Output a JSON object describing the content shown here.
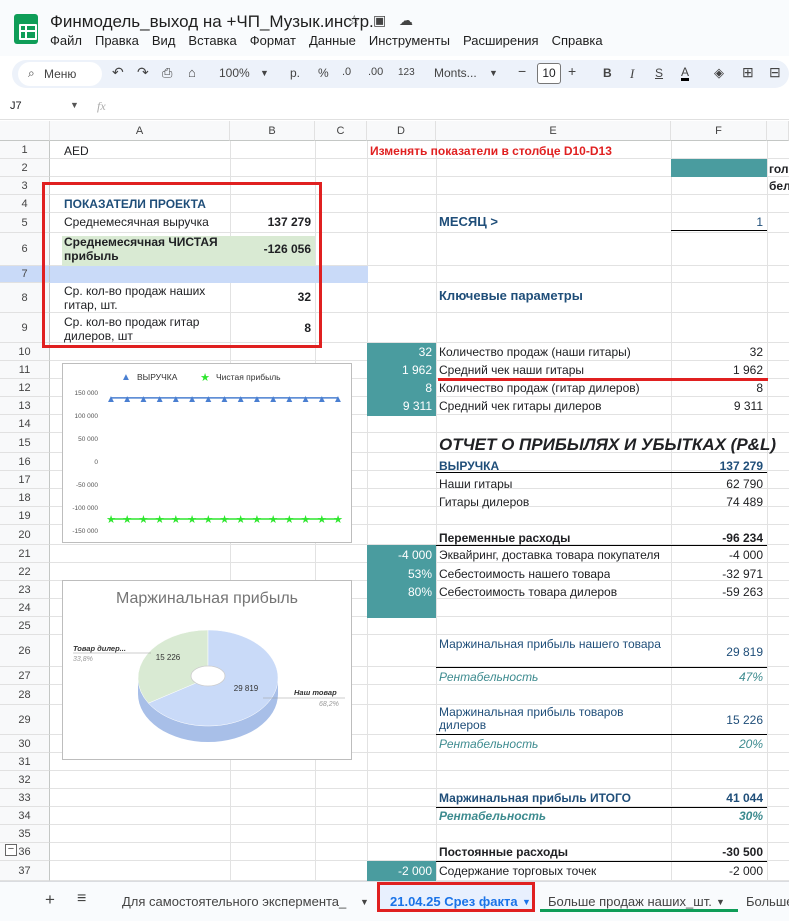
{
  "title": "Финмодель_выход на +ЧП_Музык.инстр.",
  "menu": [
    "Файл",
    "Правка",
    "Вид",
    "Вставка",
    "Формат",
    "Данные",
    "Инструменты",
    "Расширения",
    "Справка"
  ],
  "toolbar": {
    "search": "Меню",
    "zoom": "100%",
    "currency": "р.",
    "percent": "%",
    "dec_dec": ".0",
    "dec_inc": ".00",
    "numfmt": "123",
    "font": "Monts...",
    "font_size": "10",
    "bold": "B",
    "italic": "I",
    "textcolor": "A"
  },
  "formula_bar": {
    "cell_ref": "J7",
    "fx": "fx"
  },
  "columns": [
    "A",
    "B",
    "C",
    "D",
    "E",
    "F"
  ],
  "rows": [
    "1",
    "2",
    "3",
    "4",
    "5",
    "6",
    "7",
    "8",
    "9",
    "10",
    "11",
    "12",
    "13",
    "14",
    "15",
    "16",
    "17",
    "18",
    "19",
    "20",
    "21",
    "22",
    "23",
    "24",
    "25",
    "26",
    "27",
    "28",
    "29",
    "30",
    "31",
    "32",
    "33",
    "34",
    "35",
    "36",
    "37"
  ],
  "cells": {
    "a1": "AED",
    "d1": "Изменять показатели в столбце D10-D13",
    "g2": "гол",
    "g3": "бел",
    "a4": "ПОКАЗАТЕЛИ ПРОЕКТА",
    "a5": "Среднемесячная выручка",
    "b5": "137 279",
    "a6": "Среднемесячная ЧИСТАЯ прибыль",
    "b6": "-126 056",
    "a8": "Ср. кол-во продаж наших гитар, шт.",
    "b8": "32",
    "a9": "Ср. кол-во продаж гитар дилеров, шт",
    "b9": "8",
    "e5": "МЕСЯЦ >",
    "f5": "1",
    "e8": "Ключевые параметры",
    "d10": "32",
    "e10": "Количество продаж (наши гитары)",
    "f10": "32",
    "d11": "1 962",
    "e11": "Средний чек наши гитары",
    "f11": "1 962",
    "d12": "8",
    "e12": "Количество продаж (гитар дилеров)",
    "f12": "8",
    "d13": "9 311",
    "e13": "Средний чек гитары дилеров",
    "f13": "9 311",
    "e15": "ОТЧЕТ О ПРИБЫЛЯХ И УБЫТКАХ (P&L)",
    "e16": "ВЫРУЧКА",
    "f16": "137 279",
    "e17": "Наши гитары",
    "f17": "62 790",
    "e18": "Гитары дилеров",
    "f18": "74 489",
    "e20": "Переменные расходы",
    "f20": "-96 234",
    "d21": "-4 000",
    "e21": "Эквайринг, доставка товара покупателя",
    "f21": "-4 000",
    "d22": "53%",
    "e22": "Себестоимость нашего товара",
    "f22": "-32 971",
    "d23": "80%",
    "e23": "Себестоимость товара дилеров",
    "f23": "-59 263",
    "e26": "Маржинальная прибыль нашего товара",
    "f26": "29 819",
    "e27": "Рентабельность",
    "f27": "47%",
    "e29": "Маржинальная прибыль товаров дилеров",
    "f29": "15 226",
    "e30": "Рентабельность",
    "f30": "20%",
    "e33": "Маржинальная прибыль ИТОГО",
    "f33": "41 044",
    "e34": "Рентабельность",
    "f34": "30%",
    "e36": "Постоянные расходы",
    "f36": "-30 500",
    "d37": "-2 000",
    "e37": "Содержание торговых точек",
    "f37": "-2 000"
  },
  "chart_data": [
    {
      "type": "line",
      "legend": [
        "ВЫРУЧКА",
        "Чистая прибыль"
      ],
      "legend_position": "top-left",
      "ytick_labels": [
        "150 000",
        "100 000",
        "50 000",
        "0",
        "-50 000",
        "-100 000",
        "-150 000"
      ],
      "ylim": [
        -150000,
        150000
      ],
      "x": [
        1,
        2,
        3,
        4,
        5,
        6,
        7,
        8,
        9,
        10,
        11,
        12,
        13,
        14,
        15
      ],
      "series": [
        {
          "name": "ВЫРУЧКА",
          "values": [
            137279,
            137279,
            137279,
            137279,
            137279,
            137279,
            137279,
            137279,
            137279,
            137279,
            137279,
            137279,
            137279,
            137279,
            137279
          ],
          "color": "#4a7fd1"
        },
        {
          "name": "Чистая прибыль",
          "values": [
            -126056,
            -126056,
            -126056,
            -126056,
            -126056,
            -126056,
            -126056,
            -126056,
            -126056,
            -126056,
            -126056,
            -126056,
            -126056,
            -126056,
            -126056
          ],
          "color": "#2ee62e"
        }
      ]
    },
    {
      "type": "pie",
      "title": "Маржинальная прибыль",
      "slices": [
        {
          "label": "Наш товар",
          "value": 29819,
          "pct": "68,2%",
          "color": "#c9daf8"
        },
        {
          "label": "Товар дилер...",
          "value": 15226,
          "pct": "33,8%",
          "color": "#d9ead3"
        }
      ]
    }
  ],
  "sheet_tabs": {
    "add": "+",
    "list": "≡",
    "tab1": "Для самостоятельного экспермента_",
    "tab2": "21.04.25 Срез факта",
    "tab3": "Больше продаж наших_шт.",
    "tab4": "Больше"
  },
  "colors": {
    "teal": "#4a9c9f",
    "highlight_red": "#e02020",
    "active_tab": "#1a73e8"
  }
}
